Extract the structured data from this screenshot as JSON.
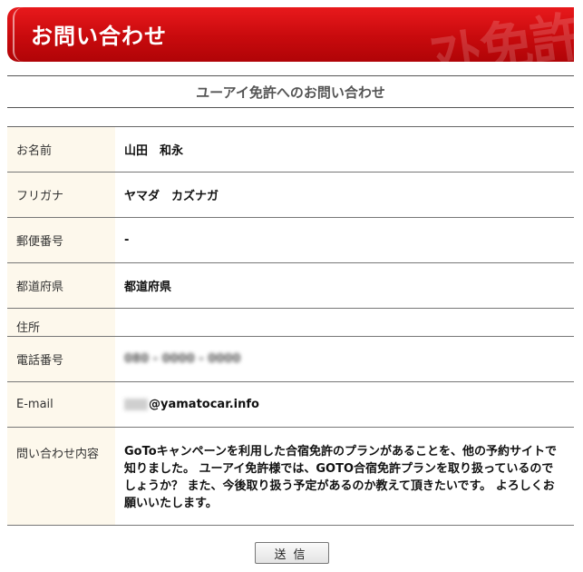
{
  "header": {
    "title": "お問い合わせ",
    "watermark": "ﾏﾄ免許"
  },
  "subtitle": "ユーアイ免許へのお問い合わせ",
  "form": {
    "name": {
      "label": "お名前",
      "value": "山田　和永"
    },
    "furigana": {
      "label": "フリガナ",
      "value": "ヤマダ　カズナガ"
    },
    "postal": {
      "label": "郵便番号",
      "value": "-"
    },
    "prefecture": {
      "label": "都道府県",
      "value": "都道府県"
    },
    "address": {
      "label": "住所",
      "value": ""
    },
    "phone": {
      "label": "電話番号",
      "value": "080 - 0000 - 0000"
    },
    "email": {
      "label": "E-mail",
      "value": "@yamatocar.info"
    },
    "message": {
      "label": "問い合わせ内容",
      "value": "GoToキャンペーンを利用した合宿免許のプランがあることを、他の予約サイトで知りました。 ユーアイ免許様では、GOTO合宿免許プランを取り扱っているのでしょうか？ また、今後取り扱う予定があるのか教えて頂きたいです。 よろしくお願いいたします。"
    }
  },
  "submit_label": "送信"
}
